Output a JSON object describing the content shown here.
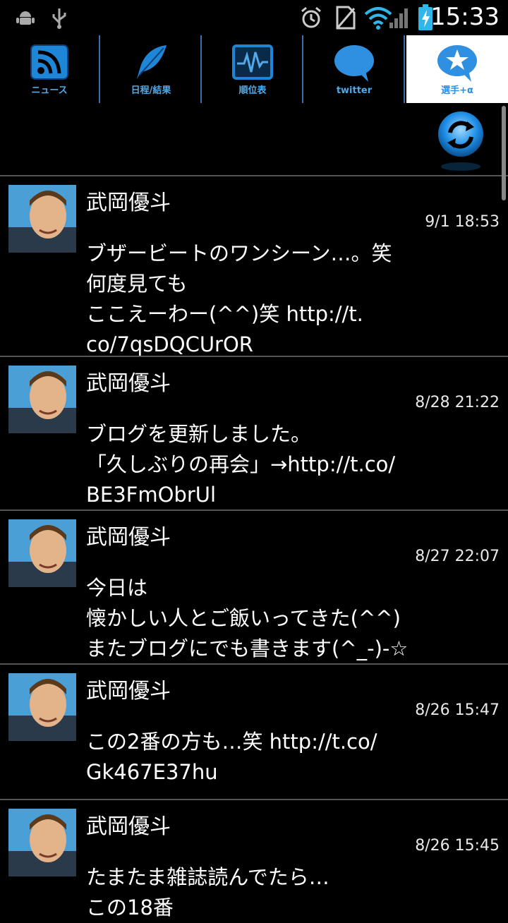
{
  "status_bar": {
    "time": "15:33",
    "icons": [
      "android-debug-icon",
      "usb-icon",
      "alarm-icon",
      "no-sim-icon",
      "wifi-icon",
      "signal-icon",
      "battery-charging-icon"
    ]
  },
  "tabs": [
    {
      "label": "ニュース",
      "icon": "rss-icon"
    },
    {
      "label": "日程/結果",
      "icon": "feather-icon"
    },
    {
      "label": "順位表",
      "icon": "chart-monitor-icon"
    },
    {
      "label": "twitter",
      "icon": "speech-bubble-icon"
    },
    {
      "label": "選手+α",
      "icon": "star-bubble-icon",
      "active": true
    }
  ],
  "tweets": [
    {
      "name": "武岡優斗",
      "time": "9/1 18:53",
      "text": "ブザービートのワンシーン…。笑\n何度見ても\nここえーわー(^^)笑 http://t.\nco/7qsDQCUrOR"
    },
    {
      "name": "武岡優斗",
      "time": "8/28 21:22",
      "text": "ブログを更新しました。\n「久しぶりの再会」→http://t.co/\nBE3FmObrUl"
    },
    {
      "name": "武岡優斗",
      "time": "8/27 22:07",
      "text": "今日は\n懐かしい人とご飯いってきた(^^)\nまたブログにでも書きます(^_-)-☆"
    },
    {
      "name": "武岡優斗",
      "time": "8/26 15:47",
      "text": "この2番の方も…笑 http://t.co/\nGk467E37hu"
    },
    {
      "name": "武岡優斗",
      "time": "8/26 15:45",
      "text": "たまたま雑誌読んでたら…\nこの18番"
    }
  ],
  "colors": {
    "accent": "#2f8fe0",
    "tab_label": "#52a9e8",
    "divider": "#555555",
    "background": "#000000"
  }
}
